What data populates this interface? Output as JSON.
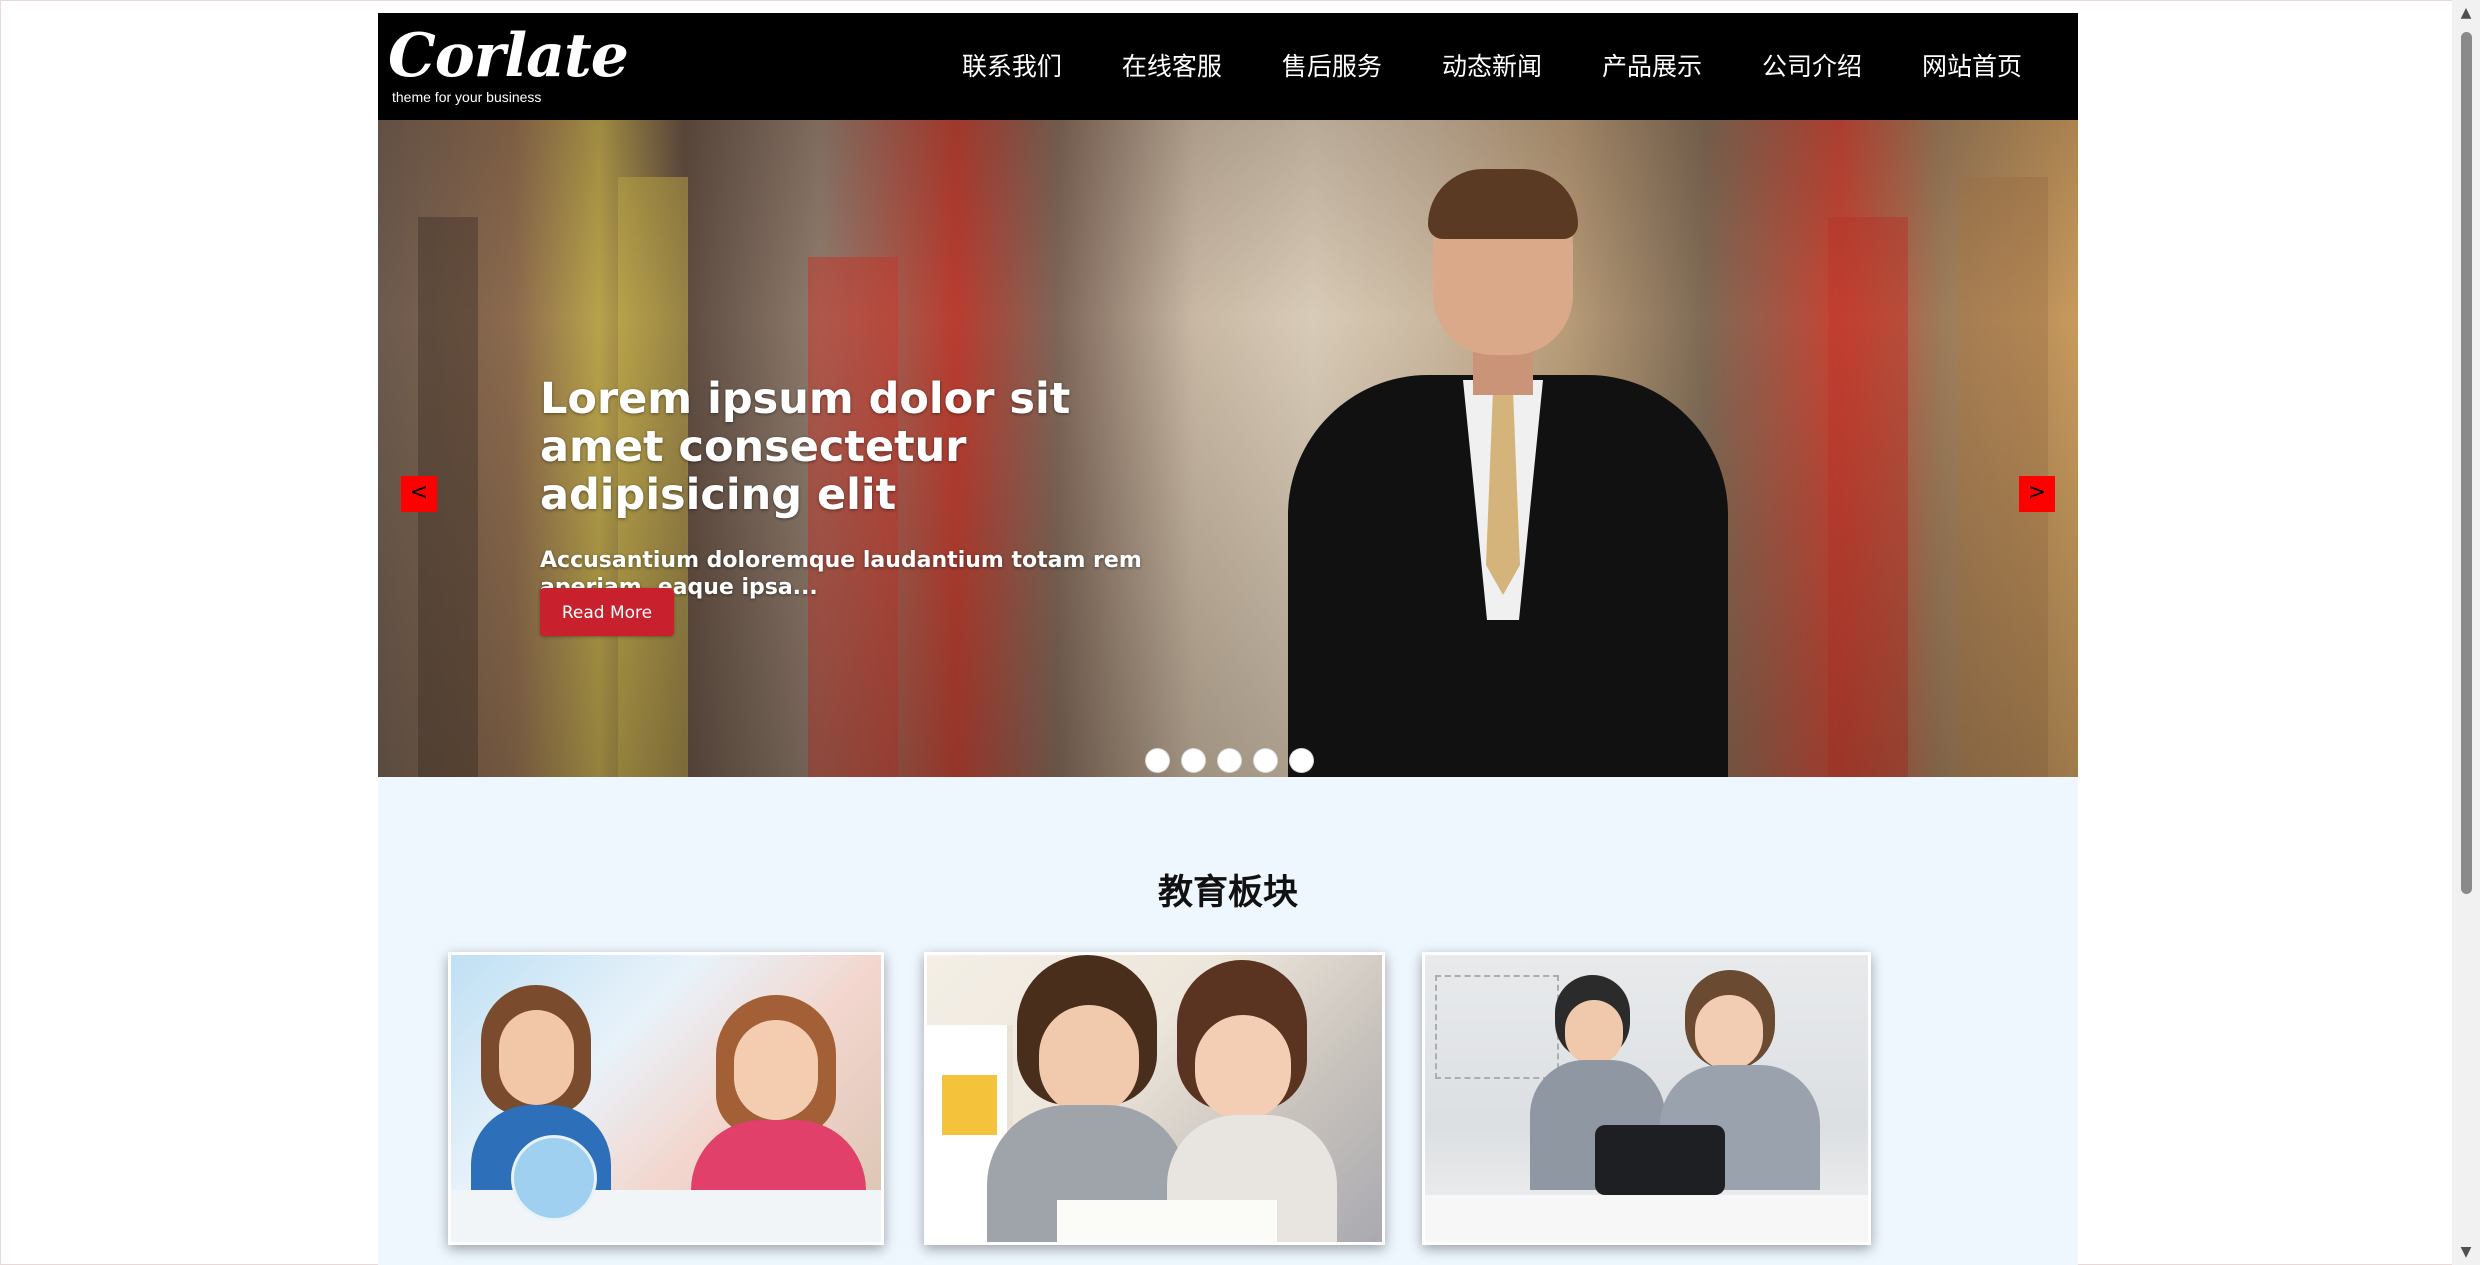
{
  "header": {
    "logo_text": "Corlate",
    "logo_tagline": "theme for your business",
    "nav": [
      {
        "label": "联系我们"
      },
      {
        "label": "在线客服"
      },
      {
        "label": "售后服务"
      },
      {
        "label": "动态新闻"
      },
      {
        "label": "产品展示"
      },
      {
        "label": "公司介绍"
      },
      {
        "label": "网站首页"
      }
    ]
  },
  "hero": {
    "title": "Lorem ipsum dolor sit amet consectetur adipisicing elit",
    "subtitle": "Accusantium doloremque laudantium totam rem aperiam, eaque ipsa...",
    "button_label": "Read More",
    "prev_label": "<",
    "next_label": ">",
    "slide_count": 5
  },
  "education": {
    "title": "教育板块"
  },
  "colors": {
    "header_bg": "#000000",
    "accent_button": "#c8202c",
    "arrow_bg": "#ff0000",
    "section_bg": "#eef6fe"
  },
  "icons": {
    "prev": "chevron-left-icon",
    "next": "chevron-right-icon",
    "scroll_up": "triangle-up-icon",
    "scroll_down": "triangle-down-icon"
  }
}
